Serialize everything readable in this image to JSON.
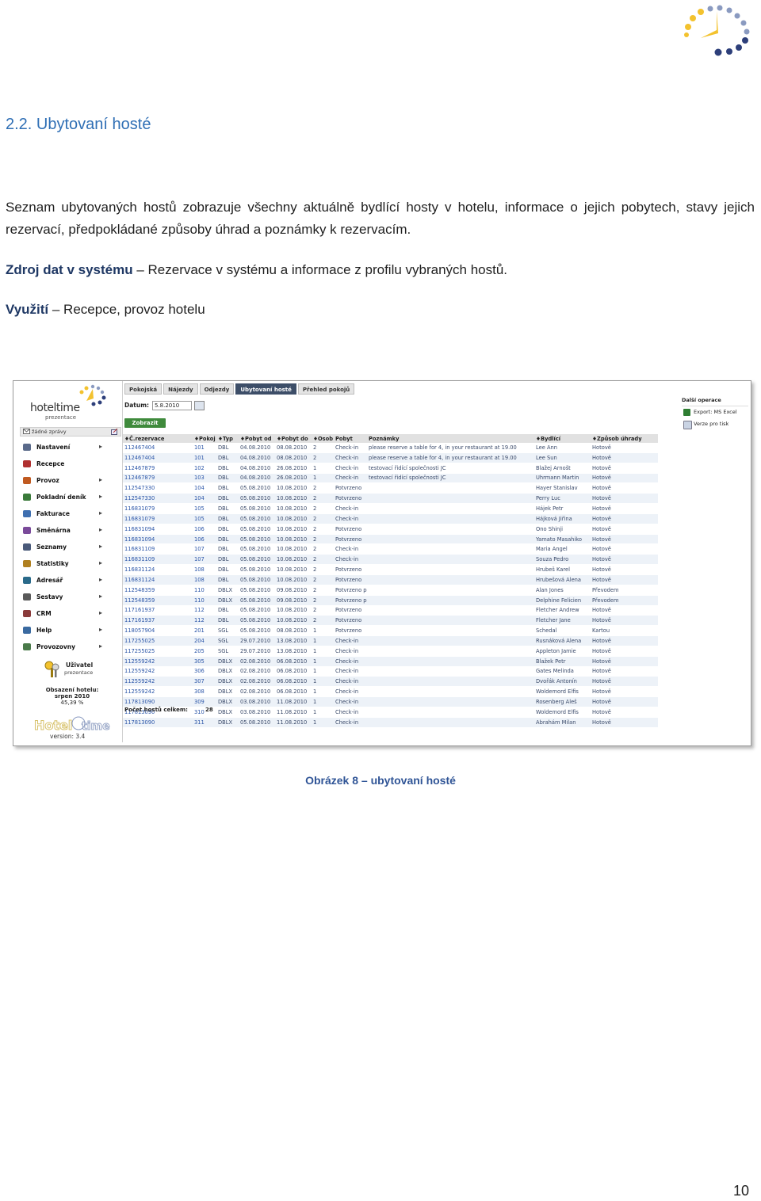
{
  "heading": "2.2. Ubytovaní hosté",
  "paragraph1": "Seznam ubytovaných hostů zobrazuje všechny aktuálně bydlící hosty v hotelu, informace o jejich pobytech, stavy jejich rezervací, předpokládané způsoby úhrad a poznámky k rezervacím.",
  "data_source": {
    "label": "Zdroj dat v systému",
    "text": " – Rezervace v systému a informace z profilu vybraných hostů."
  },
  "usage": {
    "label": "Využití",
    "text": " – Recepce, provoz hotelu"
  },
  "app": {
    "logo_brand": "hoteltime",
    "logo_sub": "prezentace",
    "messages": "žádné zprávy",
    "menu": [
      {
        "label": "Nastavení",
        "icon": "settings-icon",
        "color": "#5a6a8a"
      },
      {
        "label": "Recepce",
        "icon": "reception-icon",
        "color": "#b03030"
      },
      {
        "label": "Provoz",
        "icon": "operations-icon",
        "color": "#c05a20"
      },
      {
        "label": "Pokladní deník",
        "icon": "cashbook-icon",
        "color": "#3a7a3a"
      },
      {
        "label": "Fakturace",
        "icon": "invoice-icon",
        "color": "#3f6fb0"
      },
      {
        "label": "Směnárna",
        "icon": "exchange-icon",
        "color": "#7a4a9a"
      },
      {
        "label": "Seznamy",
        "icon": "lists-icon",
        "color": "#4a5a7a"
      },
      {
        "label": "Statistiky",
        "icon": "stats-icon",
        "color": "#b08020"
      },
      {
        "label": "Adresář",
        "icon": "address-book-icon",
        "color": "#2a6a8a"
      },
      {
        "label": "Sestavy",
        "icon": "reports-icon",
        "color": "#5a5a5a"
      },
      {
        "label": "CRM",
        "icon": "crm-icon",
        "color": "#8a3a3a"
      },
      {
        "label": "Help",
        "icon": "help-icon",
        "color": "#3a6aa0"
      },
      {
        "label": "Provozovny",
        "icon": "branches-icon",
        "color": "#4a7a4a"
      }
    ],
    "user_label": "Uživatel",
    "user_sub": "prezentace",
    "occupancy_label": "Obsazení hotelu:",
    "occupancy_month": "srpen 2010",
    "occupancy_value": "45,39 %",
    "version": "version: 3.4",
    "tabs": [
      "Pokojská",
      "Nájezdy",
      "Odjezdy",
      "Ubytovaní hosté",
      "Přehled pokojů"
    ],
    "date_label": "Datum:",
    "date_value": "5.8.2010",
    "show_button": "Zobrazit",
    "actions_title": "Další operace",
    "actions": [
      "Export: MS Excel",
      "Verze pro tisk"
    ],
    "columns": [
      "♦Č.rezervace",
      "♦Pokoj",
      "♦Typ",
      "♦Pobyt od",
      "♦Pobyt do",
      "♦Osob",
      "Pobyt",
      "Poznámky",
      "♦Bydlící",
      "♦Způsob úhrady"
    ],
    "rows": [
      [
        "112467404",
        "101",
        "DBL",
        "04.08.2010",
        "08.08.2010",
        "2",
        "Check-in",
        "please reserve a table for 4, in your restaurant at 19.00",
        "Lee Ann",
        "Hotově"
      ],
      [
        "112467404",
        "101",
        "DBL",
        "04.08.2010",
        "08.08.2010",
        "2",
        "Check-in",
        "please reserve a table for 4, in your restaurant at 19.00",
        "Lee Sun",
        "Hotově"
      ],
      [
        "112467879",
        "102",
        "DBL",
        "04.08.2010",
        "26.08.2010",
        "1",
        "Check-in",
        "testovací řidící společnosti JC",
        "Blažej Arnošt",
        "Hotově"
      ],
      [
        "112467879",
        "103",
        "DBL",
        "04.08.2010",
        "26.08.2010",
        "1",
        "Check-in",
        "testovací řidící společnosti JC",
        "Uhrmann Martin",
        "Hotově"
      ],
      [
        "112547330",
        "104",
        "DBL",
        "05.08.2010",
        "10.08.2010",
        "2",
        "Potvrzeno",
        "",
        "Hayer Stanislav",
        "Hotově"
      ],
      [
        "112547330",
        "104",
        "DBL",
        "05.08.2010",
        "10.08.2010",
        "2",
        "Potvrzeno",
        "",
        "Perry Luc",
        "Hotově"
      ],
      [
        "116831079",
        "105",
        "DBL",
        "05.08.2010",
        "10.08.2010",
        "2",
        "Check-in",
        "",
        "Hájek Petr",
        "Hotově"
      ],
      [
        "116831079",
        "105",
        "DBL",
        "05.08.2010",
        "10.08.2010",
        "2",
        "Check-in",
        "",
        "Hájková Jiřina",
        "Hotově"
      ],
      [
        "116831094",
        "106",
        "DBL",
        "05.08.2010",
        "10.08.2010",
        "2",
        "Potvrzeno",
        "",
        "Ono Shinji",
        "Hotově"
      ],
      [
        "116831094",
        "106",
        "DBL",
        "05.08.2010",
        "10.08.2010",
        "2",
        "Potvrzeno",
        "",
        "Yamato Masahiko",
        "Hotově"
      ],
      [
        "116831109",
        "107",
        "DBL",
        "05.08.2010",
        "10.08.2010",
        "2",
        "Check-in",
        "",
        "Maria Angel",
        "Hotově"
      ],
      [
        "116831109",
        "107",
        "DBL",
        "05.08.2010",
        "10.08.2010",
        "2",
        "Check-in",
        "",
        "Souza Pedro",
        "Hotově"
      ],
      [
        "116831124",
        "108",
        "DBL",
        "05.08.2010",
        "10.08.2010",
        "2",
        "Potvrzeno",
        "",
        "Hrubeš Karel",
        "Hotově"
      ],
      [
        "116831124",
        "108",
        "DBL",
        "05.08.2010",
        "10.08.2010",
        "2",
        "Potvrzeno",
        "",
        "Hrubešová Alena",
        "Hotově"
      ],
      [
        "112548359",
        "110",
        "DBLX",
        "05.08.2010",
        "09.08.2010",
        "2",
        "Potvrzeno pozdní příjezd",
        "",
        "Alan Jones",
        "Převodem"
      ],
      [
        "112548359",
        "110",
        "DBLX",
        "05.08.2010",
        "09.08.2010",
        "2",
        "Potvrzeno pozdní příjezd",
        "",
        "Delphine Felicien",
        "Převodem"
      ],
      [
        "117161937",
        "112",
        "DBL",
        "05.08.2010",
        "10.08.2010",
        "2",
        "Potvrzeno",
        "",
        "Fletcher Andrew",
        "Hotově"
      ],
      [
        "117161937",
        "112",
        "DBL",
        "05.08.2010",
        "10.08.2010",
        "2",
        "Potvrzeno",
        "",
        "Fletcher Jane",
        "Hotově"
      ],
      [
        "118057904",
        "201",
        "SGL",
        "05.08.2010",
        "08.08.2010",
        "1",
        "Potvrzeno",
        "",
        "Schedal",
        "Kartou"
      ],
      [
        "117255025",
        "204",
        "SGL",
        "29.07.2010",
        "13.08.2010",
        "1",
        "Check-in",
        "",
        "Rusnáková Alena",
        "Hotově"
      ],
      [
        "117255025",
        "205",
        "SGL",
        "29.07.2010",
        "13.08.2010",
        "1",
        "Check-in",
        "",
        "Appleton Jamie",
        "Hotově"
      ],
      [
        "112559242",
        "305",
        "DBLX",
        "02.08.2010",
        "06.08.2010",
        "1",
        "Check-in",
        "",
        "Blažek Petr",
        "Hotově"
      ],
      [
        "112559242",
        "306",
        "DBLX",
        "02.08.2010",
        "06.08.2010",
        "1",
        "Check-in",
        "",
        "Gates Melinda",
        "Hotově"
      ],
      [
        "112559242",
        "307",
        "DBLX",
        "02.08.2010",
        "06.08.2010",
        "1",
        "Check-in",
        "",
        "Dvořák Antonín",
        "Hotově"
      ],
      [
        "112559242",
        "308",
        "DBLX",
        "02.08.2010",
        "06.08.2010",
        "1",
        "Check-in",
        "",
        "Woldemord Elfis",
        "Hotově"
      ],
      [
        "117813090",
        "309",
        "DBLX",
        "03.08.2010",
        "11.08.2010",
        "1",
        "Check-in",
        "",
        "Rosenberg Aleš",
        "Hotově"
      ],
      [
        "117813090",
        "310",
        "DBLX",
        "03.08.2010",
        "11.08.2010",
        "1",
        "Check-in",
        "",
        "Woldemord Elfis",
        "Hotově"
      ],
      [
        "117813090",
        "311",
        "DBLX",
        "05.08.2010",
        "11.08.2010",
        "1",
        "Check-in",
        "",
        "Abrahám Milan",
        "Hotově"
      ]
    ],
    "total_label": "Počet hostů celkem:",
    "total_value": "28"
  },
  "caption": "Obrázek 8 – ubytovaní hosté",
  "page_number": "10"
}
